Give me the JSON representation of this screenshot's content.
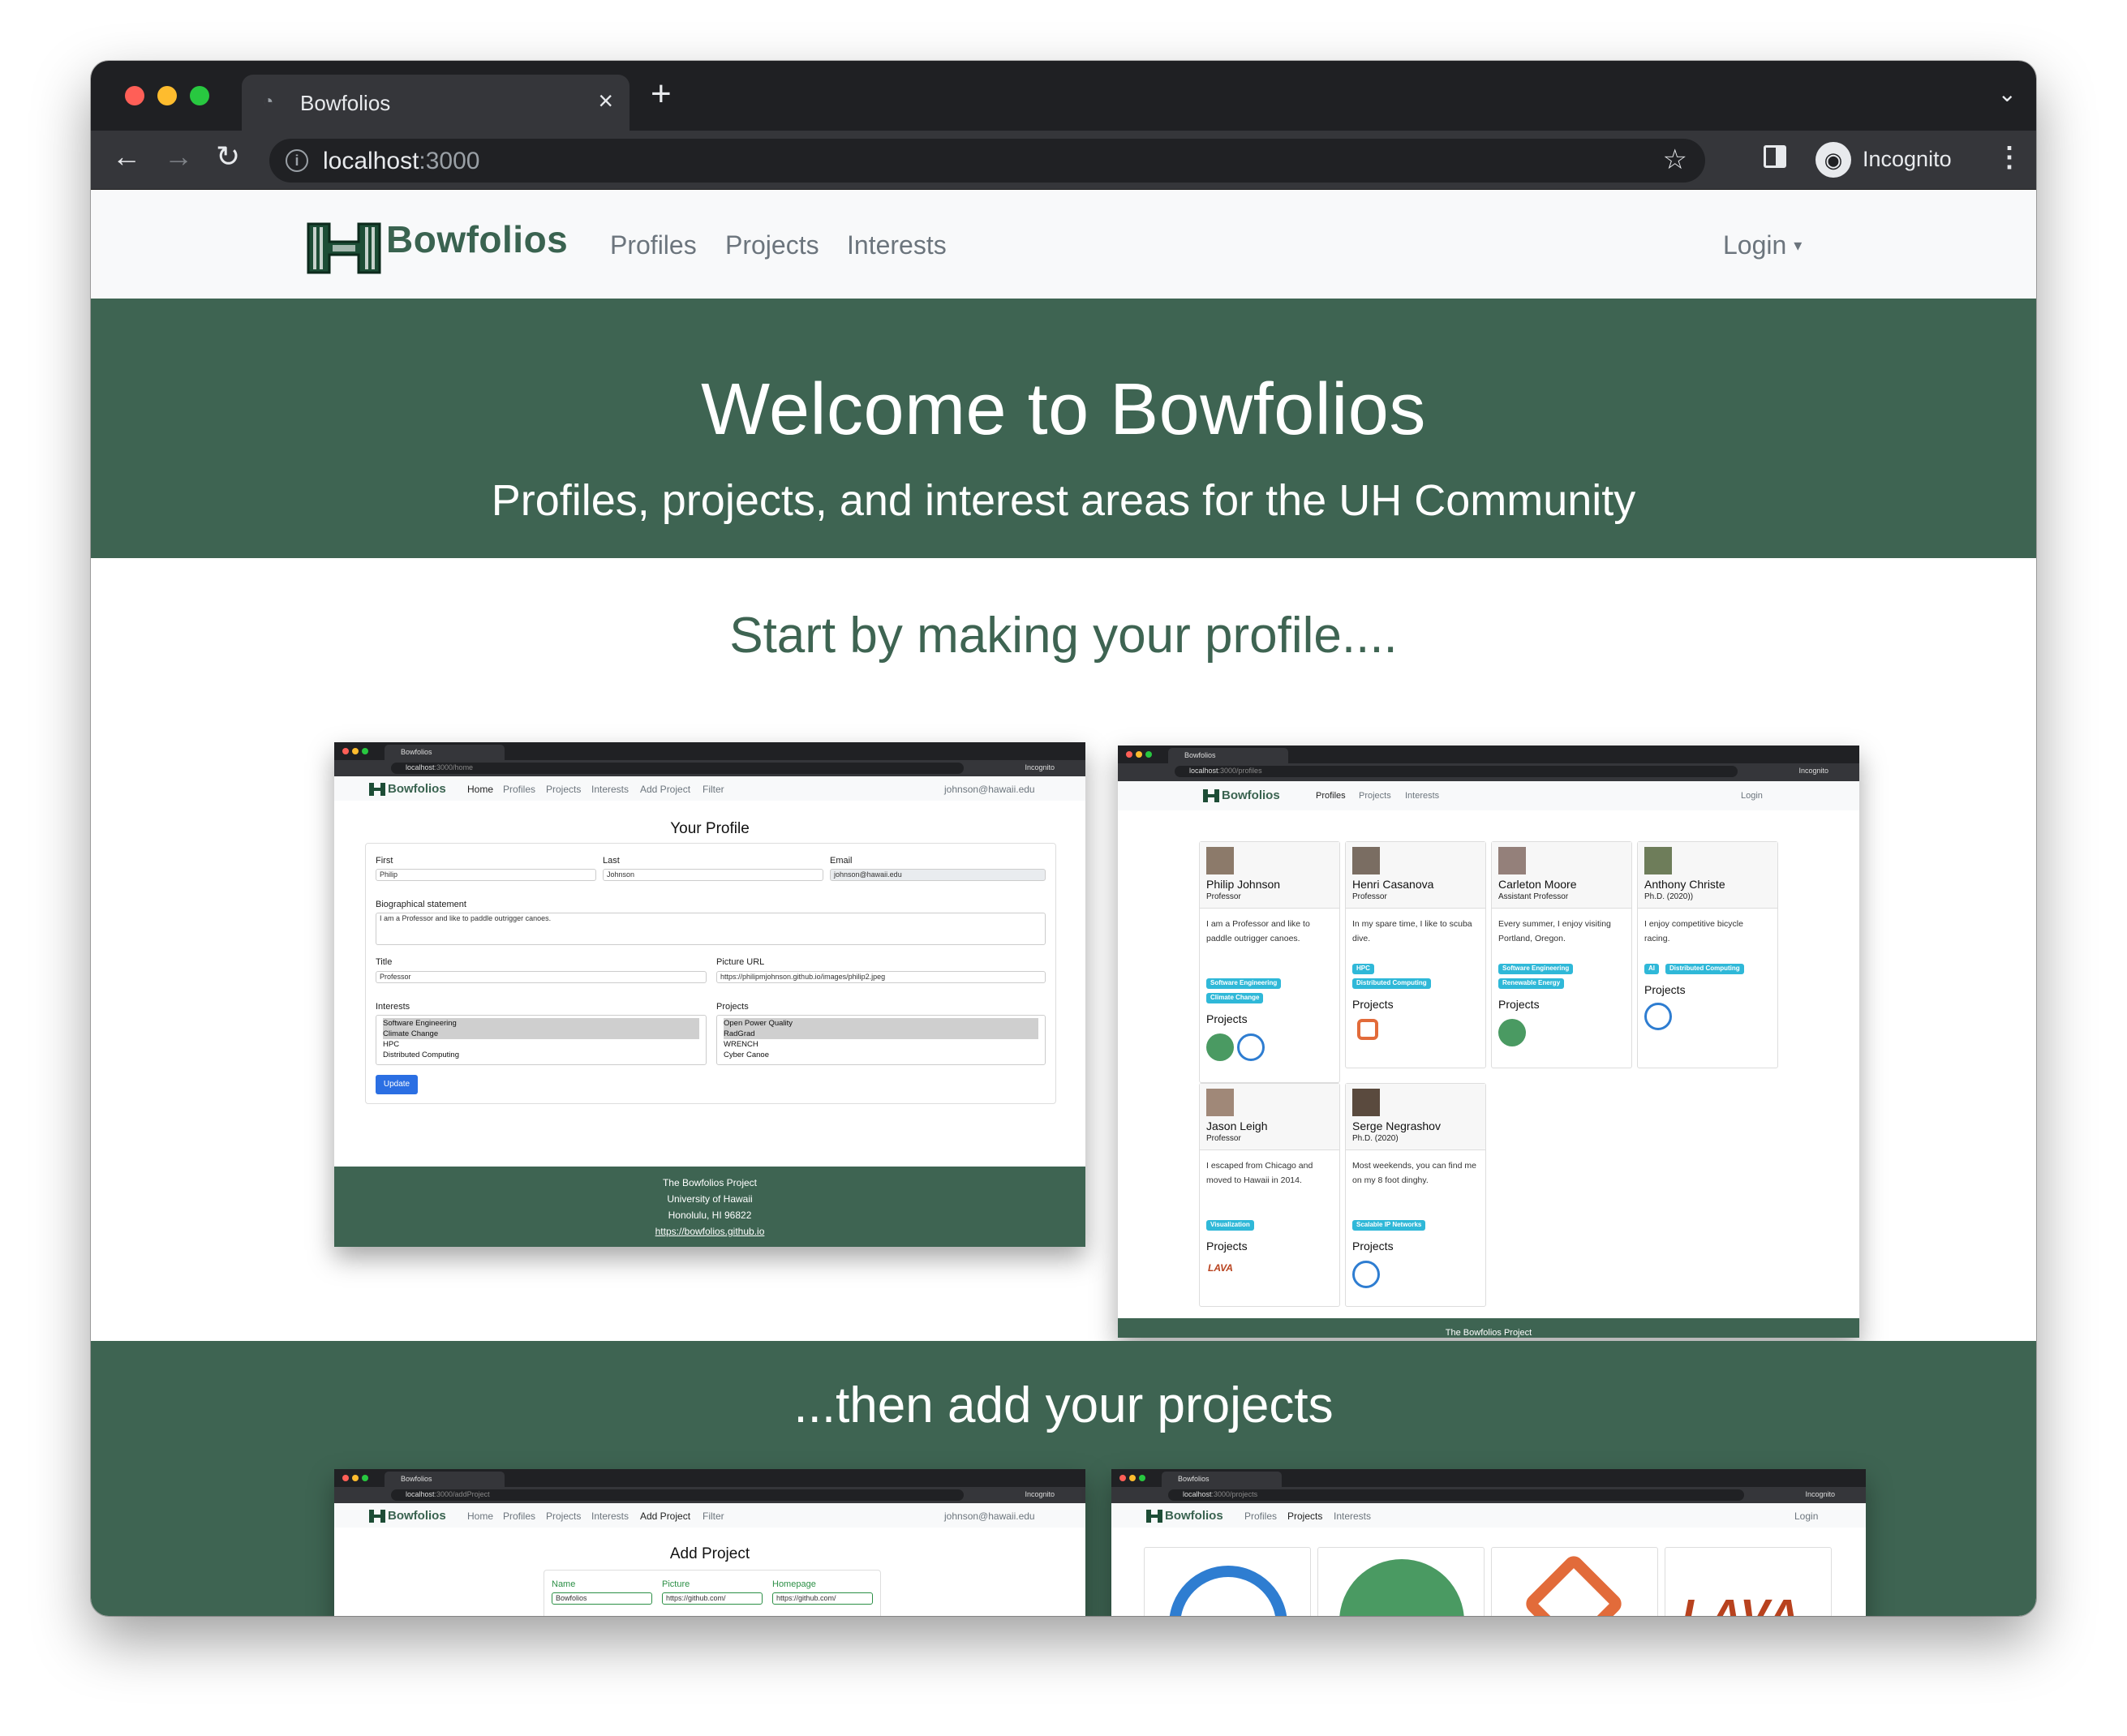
{
  "browser": {
    "tab_title": "Bowfolios",
    "url_host": "localhost",
    "url_port": ":3000",
    "profile_label": "Incognito"
  },
  "nav": {
    "brand": "Bowfolios",
    "links": [
      "Profiles",
      "Projects",
      "Interests"
    ],
    "login": "Login"
  },
  "hero": {
    "title": "Welcome to Bowfolios",
    "subtitle": "Profiles, projects, and interest areas for the UH Community"
  },
  "section1": {
    "heading": "Start by making your profile...."
  },
  "section2": {
    "heading": "...then add your projects"
  },
  "shot_home": {
    "tab": "Bowfolios",
    "url_host": "localhost",
    "url_path": ":3000/home",
    "incognito": "Incognito",
    "brand": "Bowfolios",
    "links": [
      "Home",
      "Profiles",
      "Projects",
      "Interests",
      "Add Project",
      "Filter"
    ],
    "user": "johnson@hawaii.edu",
    "heading": "Your Profile",
    "first_label": "First",
    "first_value": "Philip",
    "last_label": "Last",
    "last_value": "Johnson",
    "email_label": "Email",
    "email_value": "johnson@hawaii.edu",
    "bio_label": "Biographical statement",
    "bio_value": "I am a Professor and like to paddle outrigger canoes.",
    "title_label": "Title",
    "title_value": "Professor",
    "picture_label": "Picture URL",
    "picture_value": "https://philipmjohnson.github.io/images/philip2.jpeg",
    "interests_label": "Interests",
    "interests": [
      "Software Engineering",
      "Climate Change",
      "HPC",
      "Distributed Computing"
    ],
    "projects_label": "Projects",
    "projects": [
      "Open Power Quality",
      "RadGrad",
      "WRENCH",
      "Cyber Canoe"
    ],
    "update": "Update",
    "footer": [
      "The Bowfolios Project",
      "University of Hawaii",
      "Honolulu, HI 96822",
      "https://bowfolios.github.io"
    ]
  },
  "shot_profiles": {
    "tab": "Bowfolios",
    "url_host": "localhost",
    "url_path": ":3000/profiles",
    "incognito": "Incognito",
    "brand": "Bowfolios",
    "links": [
      "Profiles",
      "Projects",
      "Interests"
    ],
    "login": "Login",
    "projects_label": "Projects",
    "cards": [
      {
        "name": "Philip Johnson",
        "role": "Professor",
        "bio": "I am a Professor and like to paddle outrigger canoes.",
        "badges": [
          "Software Engineering",
          "Climate Change"
        ]
      },
      {
        "name": "Henri Casanova",
        "role": "Professor",
        "bio": "In my spare time, I like to scuba dive.",
        "badges": [
          "HPC",
          "Distributed Computing"
        ]
      },
      {
        "name": "Carleton Moore",
        "role": "Assistant Professor",
        "bio": "Every summer, I enjoy visiting Portland, Oregon.",
        "badges": [
          "Software Engineering",
          "Renewable Energy"
        ]
      },
      {
        "name": "Anthony Christe",
        "role": "Ph.D. (2020))",
        "bio": "I enjoy competitive bicycle racing.",
        "badges": [
          "AI",
          "Distributed Computing"
        ]
      },
      {
        "name": "Jason Leigh",
        "role": "Professor",
        "bio": "I escaped from Chicago and moved to Hawaii in 2014.",
        "badges": [
          "Visualization"
        ]
      },
      {
        "name": "Serge Negrashov",
        "role": "Ph.D. (2020)",
        "bio": "Most weekends, you can find me on my 8 foot dinghy.",
        "badges": [
          "Scalable IP Networks"
        ]
      }
    ],
    "footer": "The Bowfolios Project"
  },
  "shot_add": {
    "tab": "Bowfolios",
    "url_host": "localhost",
    "url_path": ":3000/addProject",
    "incognito": "Incognito",
    "brand": "Bowfolios",
    "links": [
      "Home",
      "Profiles",
      "Projects",
      "Interests",
      "Add Project",
      "Filter"
    ],
    "user": "johnson@hawaii.edu",
    "heading": "Add Project",
    "name_label": "Name",
    "name_value": "Bowfolios",
    "picture_label": "Picture",
    "picture_value": "https://github.com/",
    "homepage_label": "Homepage",
    "homepage_value": "https://github.com/"
  },
  "shot_projects": {
    "tab": "Bowfolios",
    "url_host": "localhost",
    "url_path": ":3000/projects",
    "incognito": "Incognito",
    "brand": "Bowfolios",
    "links": [
      "Profiles",
      "Projects",
      "Interests"
    ],
    "login": "Login",
    "lava": "LAVA"
  },
  "colors": {
    "brand_green": "#3e6452",
    "badge": "#2fb8d8",
    "update_button": "#2b6fe3"
  }
}
